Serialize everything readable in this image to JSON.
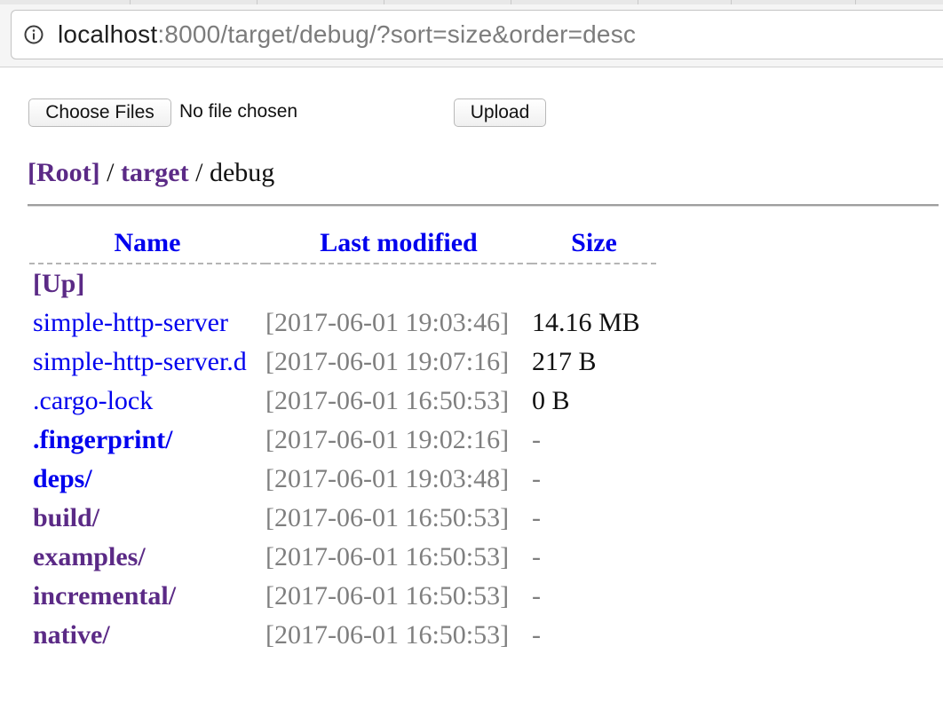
{
  "browser": {
    "url_host": "localhost",
    "url_rest": ":8000/target/debug/?sort=size&order=desc"
  },
  "upload": {
    "choose_label": "Choose Files",
    "no_file_label": "No file chosen",
    "upload_label": "Upload"
  },
  "breadcrumb": {
    "root": "[Root]",
    "sep1": " / ",
    "parent": "target",
    "sep2": " / ",
    "current": "debug"
  },
  "table": {
    "headers": {
      "name": "Name",
      "modified": "Last modified",
      "size": "Size"
    },
    "up_label": "[Up]",
    "rows": [
      {
        "name": "simple-http-server",
        "modified": "[2017-06-01 19:03:46]",
        "size": "14.16 MB",
        "kind": "file"
      },
      {
        "name": "simple-http-server.d",
        "modified": "[2017-06-01 19:07:16]",
        "size": "217 B",
        "kind": "file"
      },
      {
        "name": ".cargo-lock",
        "modified": "[2017-06-01 16:50:53]",
        "size": "0 B",
        "kind": "file"
      },
      {
        "name": ".fingerprint/",
        "modified": "[2017-06-01 19:02:16]",
        "size": "-",
        "kind": "dir"
      },
      {
        "name": "deps/",
        "modified": "[2017-06-01 19:03:48]",
        "size": "-",
        "kind": "dir"
      },
      {
        "name": "build/",
        "modified": "[2017-06-01 16:50:53]",
        "size": "-",
        "kind": "visited"
      },
      {
        "name": "examples/",
        "modified": "[2017-06-01 16:50:53]",
        "size": "-",
        "kind": "visited"
      },
      {
        "name": "incremental/",
        "modified": "[2017-06-01 16:50:53]",
        "size": "-",
        "kind": "visited"
      },
      {
        "name": "native/",
        "modified": "[2017-06-01 16:50:53]",
        "size": "-",
        "kind": "visited"
      }
    ]
  },
  "colors": {
    "link": "#0000ee",
    "visited_link": "#5b2a86",
    "timestamp": "#7f7f7f"
  }
}
